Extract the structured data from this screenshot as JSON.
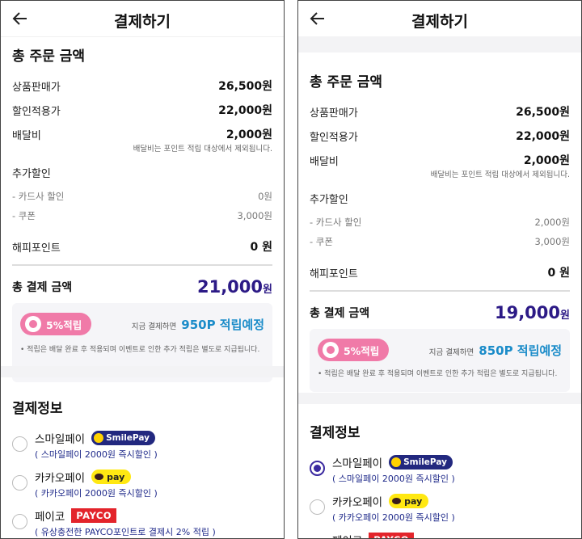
{
  "left": {
    "header": {
      "title": "결제하기"
    },
    "order": {
      "title": "총 주문 금액",
      "product_label": "상품판매가",
      "product_value": "26,500원",
      "discount_label": "할인적용가",
      "discount_value": "22,000원",
      "delivery_label": "배달비",
      "delivery_value": "2,000원",
      "delivery_note": "배달비는 포인트 적립 대상에서 제외됩니다.",
      "extra_label": "추가할인",
      "card_label": "- 카드사 할인",
      "card_value": "0원",
      "coupon_label": "- 쿠폰",
      "coupon_value": "3,000원",
      "point_label": "해피포인트",
      "point_value": "0 원",
      "total_label": "총 결제 금액",
      "total_value": "21,000",
      "total_unit": "원"
    },
    "reward": {
      "pill": "5%적립",
      "pre": "지금 결제하면",
      "earn": "950P 적립예정",
      "note": "• 적립은 배달 완료 후 적용되며 이벤트로 인한 추가 적립은 별도로 지급됩니다."
    },
    "payment": {
      "title": "결제정보",
      "methods": [
        {
          "name": "스마일페이",
          "badge": "SmilePay",
          "desc": "( 스마일페이 2000원 즉시할인 )"
        },
        {
          "name": "카카오페이",
          "badge": "pay",
          "desc": "( 카카오페이 2000원 즉시할인 )"
        },
        {
          "name": "페이코",
          "badge": "PAYCO",
          "desc": "( 유상충전한 PAYCO포인트로 결제시 2% 적립 )"
        }
      ]
    }
  },
  "right": {
    "header": {
      "title": "결제하기"
    },
    "order": {
      "title": "총 주문 금액",
      "product_label": "상품판매가",
      "product_value": "26,500원",
      "discount_label": "할인적용가",
      "discount_value": "22,000원",
      "delivery_label": "배달비",
      "delivery_value": "2,000원",
      "delivery_note": "배달비는 포인트 적립 대상에서 제외됩니다.",
      "extra_label": "추가할인",
      "card_label": "- 카드사 할인",
      "card_value": "2,000원",
      "coupon_label": "- 쿠폰",
      "coupon_value": "3,000원",
      "point_label": "해피포인트",
      "point_value": "0 원",
      "total_label": "총 결제 금액",
      "total_value": "19,000",
      "total_unit": "원"
    },
    "reward": {
      "pill": "5%적립",
      "pre": "지금 결제하면",
      "earn": "850P 적립예정",
      "note": "• 적립은 배달 완료 후 적용되며 이벤트로 인한 추가 적립은 별도로 지급됩니다."
    },
    "payment": {
      "title": "결제정보",
      "methods": [
        {
          "name": "스마일페이",
          "badge": "SmilePay",
          "desc": "( 스마일페이 2000원 즉시할인 )",
          "selected": true
        },
        {
          "name": "카카오페이",
          "badge": "pay",
          "desc": "( 카카오페이 2000원 즉시할인 )"
        },
        {
          "name": "페이코",
          "badge": "PAYCO"
        }
      ]
    }
  },
  "icons": {
    "back": "arrow-left-icon"
  },
  "colors": {
    "total": "#2c1a86",
    "earn": "#1b8cc9",
    "pill": "#f07aa8",
    "radio_selected": "#3b2aa0"
  }
}
